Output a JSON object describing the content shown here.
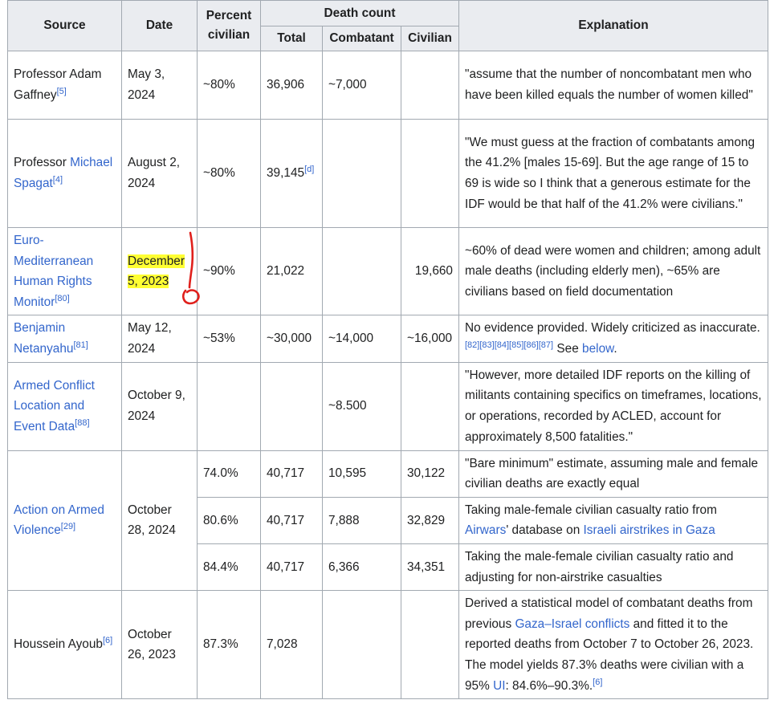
{
  "headers": {
    "source": "Source",
    "date": "Date",
    "percent": "Percent civilian",
    "death_count": "Death count",
    "total": "Total",
    "combatant": "Combatant",
    "civilian": "Civilian",
    "explanation": "Explanation"
  },
  "rows": {
    "gaffney": {
      "prefix": "Professor Adam Gaffney",
      "link": "",
      "ref": "[5]",
      "date": "May 3, 2024",
      "percent": "~80%",
      "total": "36,906",
      "combatant": "~7,000",
      "civilian": "",
      "explanation": "\"assume that the number of noncombatant men who have been killed equals the number of women killed\""
    },
    "spagat": {
      "prefix": "Professor ",
      "link": "Michael Spagat",
      "ref": "[4]",
      "date": "August 2, 2024",
      "percent": "~80%",
      "total": "39,145",
      "total_ref": "[d]",
      "combatant": "",
      "civilian": "",
      "explanation": "\"We must guess at the fraction of combatants among the 41.2% [males 15-69]. But the age range of 15 to 69 is wide so I think that a generous estimate for the IDF would be that half of the 41.2% were civilians.\""
    },
    "euromed": {
      "link": "Euro-Mediterranean Human Rights Monitor",
      "ref": "[80]",
      "date": "December 5, 2023",
      "percent": "~90%",
      "total": "21,022",
      "combatant": "",
      "civilian": "19,660",
      "explanation": "~60% of dead were women and children; among adult male deaths (including elderly men), ~65% are civilians based on field documentation"
    },
    "netanyahu": {
      "link": "Benjamin Netanyahu",
      "ref": "[81]",
      "date": "May 12, 2024",
      "percent": "~53%",
      "total": "~30,000",
      "combatant": "~14,000",
      "civilian": "~16,000",
      "explanation": "No evidence provided. Widely criticized as inaccurate.",
      "exp_refs": "[82][83][84][85][86][87]",
      "exp_see": " See ",
      "exp_link": "below",
      "exp_end": "."
    },
    "acled": {
      "link": "Armed Conflict Location and Event Data",
      "ref": "[88]",
      "date": "October 9, 2024",
      "percent": "",
      "total": "",
      "combatant": "~8.500",
      "civilian": "",
      "explanation": "\"However, more detailed IDF reports on the killing of militants containing specifics on timeframes, locations, or operations, recorded by ACLED, account for approximately 8,500 fatalities.\""
    },
    "aoav": {
      "link": "Action on Armed Violence",
      "ref": "[29]",
      "date": "October 28, 2024",
      "sub": [
        {
          "percent": "74.0%",
          "total": "40,717",
          "combatant": "10,595",
          "civilian": "30,122",
          "explanation": "\"Bare minimum\" estimate, assuming male and female civilian deaths are exactly equal"
        },
        {
          "percent": "80.6%",
          "total": "40,717",
          "combatant": "7,888",
          "civilian": "32,829",
          "exp_pre": "Taking male-female civilian casualty ratio from ",
          "exp_link1": "Airwars",
          "exp_mid": "' database on ",
          "exp_link2": "Israeli airstrikes in Gaza"
        },
        {
          "percent": "84.4%",
          "total": "40,717",
          "combatant": "6,366",
          "civilian": "34,351",
          "explanation": "Taking the male-female civilian casualty ratio and adjusting for non-airstrike casualties"
        }
      ]
    },
    "ayoub": {
      "prefix": "Houssein Ayoub",
      "ref": "[6]",
      "date": "October 26, 2023",
      "percent": "87.3%",
      "total": "7,028",
      "combatant": "",
      "civilian": "",
      "exp_pre": "Derived a statistical model of combatant deaths from previous ",
      "exp_link1": "Gaza–Israel conflicts",
      "exp_mid": " and fitted it to the reported deaths from October 7 to October 26, 2023. The model yields 87.3% deaths were civilian with a 95% ",
      "exp_link2": "UI",
      "exp_end": ": 84.6%–90.3%.",
      "exp_ref": "[6]"
    }
  },
  "colors": {
    "header_bg": "#eaecf0",
    "border": "#a2a9b1",
    "link": "#3366cc",
    "highlight": "#ffff33",
    "pen": "#e0201c"
  }
}
